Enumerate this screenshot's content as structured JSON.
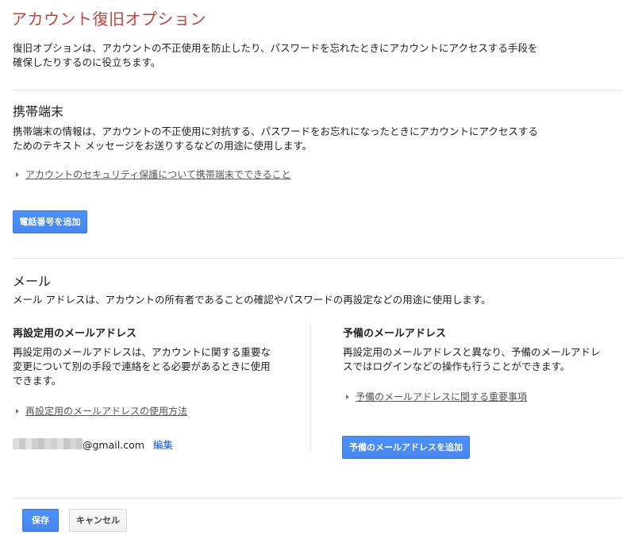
{
  "page": {
    "title": "アカウント復旧オプション",
    "intro_line1": "復旧オプションは、アカウントの不正使用を防止したり、パスワードを忘れたときにアカウントにアクセスする手段を",
    "intro_line2": "確保したりするのに役立ちます。"
  },
  "mobile": {
    "title": "携帯端末",
    "desc_line1": "携帯端末の情報は、アカウントの不正使用に対抗する、パスワードをお忘れになったときにアカウントにアクセスする",
    "desc_line2": "ためのテキスト メッセージをお送りするなどの用途に使用します。",
    "link": "アカウントのセキュリティ保護について携帯端末でできること",
    "add_phone_button": "電話番号を追加"
  },
  "mail": {
    "title": "メール",
    "desc": "メール アドレスは、アカウントの所有者であることの確認やパスワードの再設定などの用途に使用します。",
    "recovery": {
      "title": "再設定用のメールアドレス",
      "desc_line1": "再設定用のメールアドレスは、アカウントに関する重要な",
      "desc_line2": "変更について別の手段で連絡をとる必要があるときに使用",
      "desc_line3": "できます。",
      "link": "再設定用のメールアドレスの使用方法",
      "email_domain": "@gmail.com",
      "edit_link": "編集"
    },
    "backup": {
      "title": "予備のメールアドレス",
      "desc_line1": "再設定用のメールアドレスと異なり、予備のメールアドレ",
      "desc_line2": "スではログインなどの操作も行うことができます。",
      "link": "予備のメールアドレスに関する重要事項",
      "add_button": "予備のメールアドレスを追加"
    }
  },
  "footer": {
    "save_button": "保存",
    "cancel_button": "キャンセル"
  },
  "colors": {
    "title": "#c1453a",
    "primary_button": "#4d90fe",
    "link": "#1155cc"
  }
}
